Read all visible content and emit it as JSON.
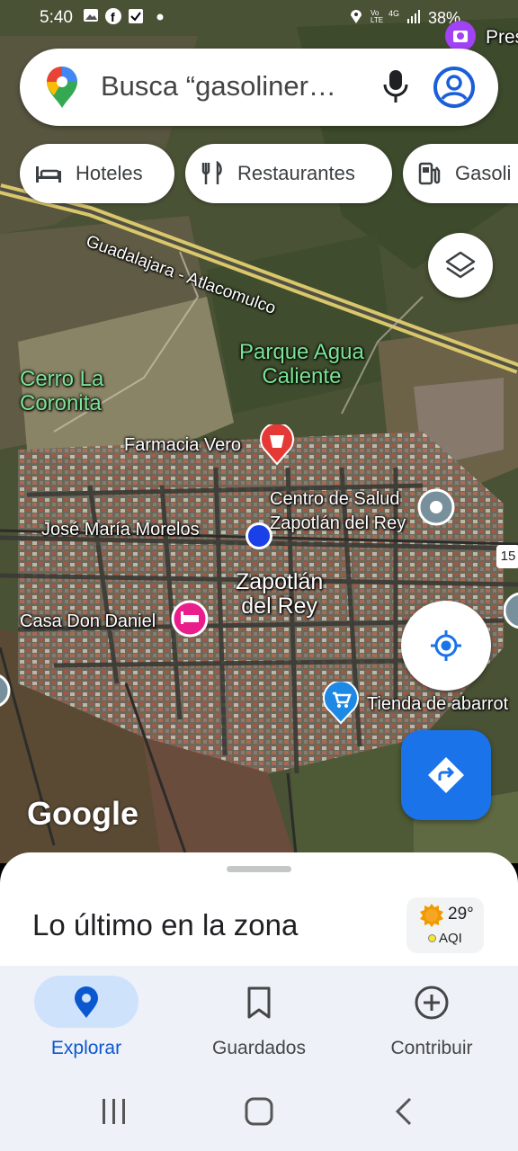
{
  "status_bar": {
    "time": "5:40",
    "network": "4G",
    "volte": "Vo LTE",
    "battery": "38%"
  },
  "search": {
    "placeholder": "Busca “gasoliner…",
    "profile_label": "Pres"
  },
  "chips": [
    {
      "label": "Hoteles",
      "icon": "bed-icon"
    },
    {
      "label": "Restaurantes",
      "icon": "fork-knife-icon"
    },
    {
      "label": "Gasoli",
      "icon": "gas-station-icon"
    }
  ],
  "map": {
    "road_name": "Guadalajara - Atlacomulco",
    "labels": {
      "parque": "Parque Agua\nCaliente",
      "cerro": "Cerro La\nCoronita",
      "farmacia": "Farmacia Vero",
      "centro_salud": "Centro de Salud\nZapotlán del Rey",
      "morelos": "José María Morelos",
      "town": "Zapotlán\ndel Rey",
      "casa": "Casa Don Daniel",
      "tienda": "Tienda de abarrot",
      "route_shield": "15"
    },
    "attribution": "Google"
  },
  "sheet": {
    "title": "Lo último en la zona",
    "weather_temp": "29°",
    "weather_aqi": "AQI"
  },
  "bottom_nav": [
    {
      "label": "Explorar",
      "active": true
    },
    {
      "label": "Guardados",
      "active": false
    },
    {
      "label": "Contribuir",
      "active": false
    }
  ],
  "colors": {
    "accent": "#1a73e8",
    "active_tab_text": "#0b57d0",
    "park_label": "#7be495"
  }
}
